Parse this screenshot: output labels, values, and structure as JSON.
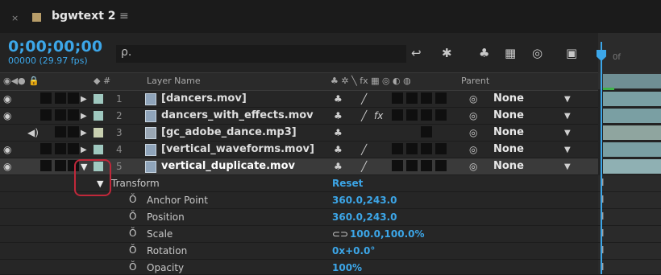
{
  "tab": {
    "close": "×",
    "title": "bgwtext 2",
    "menu": "≡",
    "swatch_color": "#b79d69"
  },
  "timecode": {
    "value": "0;00;00;00",
    "fps": "00000 (29.97 fps)"
  },
  "search": {
    "icon": "ρ."
  },
  "tools": [
    "↩",
    "✱",
    "♣",
    "▦",
    "◎",
    "▣"
  ],
  "ruler": {
    "label": "0f"
  },
  "header": {
    "av": "◉◀● 🔒",
    "label": "◆ #",
    "layer_name": "Layer Name",
    "switches": "♣ ✲ ╲ fx ▦ ◎ ◐ ◍",
    "parent": "Parent"
  },
  "layers": [
    {
      "num": "1",
      "name": "[dancers.mov]",
      "color": "#9fc8bf",
      "fx": "",
      "parent": "None",
      "video": true
    },
    {
      "num": "2",
      "name": "dancers_with_effects.mov",
      "color": "#9fc8bf",
      "fx": "fx",
      "parent": "None",
      "video": true
    },
    {
      "num": "3",
      "name": "[gc_adobe_dance.mp3]",
      "color": "#9fc8bf",
      "fx": "",
      "parent": "None",
      "video": false
    },
    {
      "num": "4",
      "name": "[vertical_waveforms.mov]",
      "color": "#9fc8bf",
      "fx": "",
      "parent": "None",
      "video": true
    },
    {
      "num": "5",
      "name": "vertical_duplicate.mov",
      "color": "#9fc8bf",
      "fx": "",
      "parent": "None",
      "video": true
    }
  ],
  "transform": {
    "label": "Transform",
    "reset": "Reset"
  },
  "properties": [
    {
      "name": "Anchor Point",
      "value": "360.0,243.0",
      "link": false
    },
    {
      "name": "Position",
      "value": "360.0,243.0",
      "link": false
    },
    {
      "name": "Scale",
      "value": "100.0,100.0%",
      "link": true
    },
    {
      "name": "Rotation",
      "value": "0x+0.0°",
      "link": false
    },
    {
      "name": "Opacity",
      "value": "100%",
      "link": false
    }
  ],
  "colors": {
    "accent": "#3ca6e8",
    "highlight": "#c0283a"
  }
}
